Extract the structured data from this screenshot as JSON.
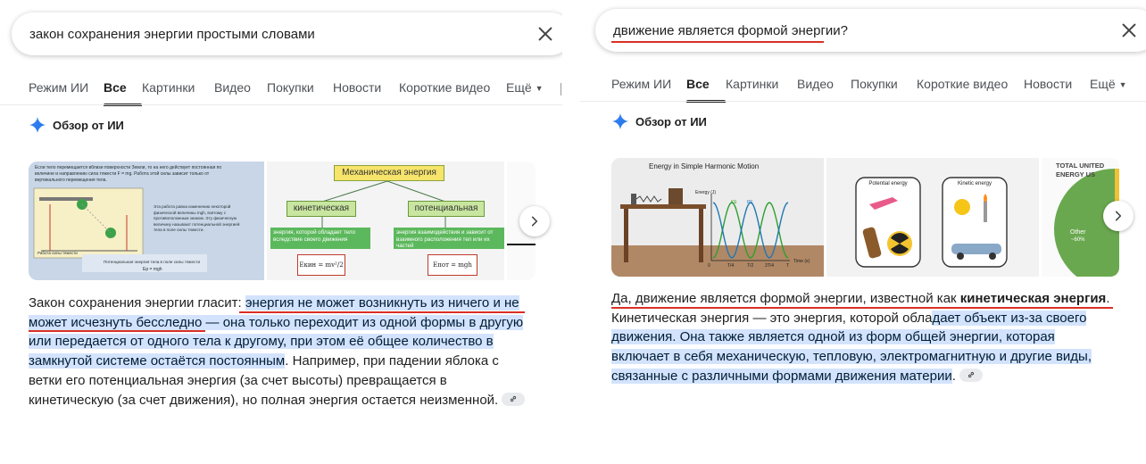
{
  "left": {
    "search": {
      "query": "закон сохранения энергии простыми словами"
    },
    "tabs": [
      {
        "label": "Режим ИИ"
      },
      {
        "label": "Все"
      },
      {
        "label": "Картинки"
      },
      {
        "label": "Видео"
      },
      {
        "label": "Покупки"
      },
      {
        "label": "Новости"
      },
      {
        "label": "Короткие видео"
      },
      {
        "label": "Ещё"
      }
    ],
    "ai_overview": {
      "label": "Обзор от ИИ"
    },
    "images": {
      "img1": {
        "lines": [
          "Если тело перемещается вблизи поверхности Земли, то на него действует постоянная по",
          "величине и направлению сила тяжести F = mg. Работа этой силы зависит только от",
          "вертикального перемещения тела.",
          "Эта работа равна изменению некоторой",
          "физической величины mgh, взятому с",
          "противоположным знаком. Эту физическую",
          "величину называют потенциальной энергией",
          "тела в поле силы тяжести.",
          "Работа силы тяжести",
          "Потенциальная энергия тела в поле силы тяжести"
        ],
        "formula": "Ep = mgh"
      },
      "img2": {
        "title": "Механическая энергия",
        "kinetic": "кинетическая",
        "potential": "потенциальная",
        "kinetic_desc": "энергия, которой обладает тело вследствие своего движения",
        "potential_desc": "энергия взаимодействия и зависит от взаимного расположения тел или их частей",
        "kinetic_formula": "Eкин = mv²/2",
        "potential_formula": "Eпот = mgh"
      }
    },
    "answer": {
      "p1": "Закон сохранения энергии гласит: ",
      "p2": "энергия не может возникнуть из ничего и не может исчезнуть бесследно",
      "p3": " — она только переходит из одной формы в другую или передается от одного тела к другому, при этом её общее количество в замкнутой системе остаётся постоянным",
      "p4": ". Например, при падении яблока с ветки его потенциальная энергия (за счет высоты) превращается в кинетическую (за счет движения), но полная энергия остается неизменной."
    }
  },
  "right": {
    "search": {
      "query": "движение является формой энергии?"
    },
    "tabs": [
      {
        "label": "Режим ИИ"
      },
      {
        "label": "Все"
      },
      {
        "label": "Картинки"
      },
      {
        "label": "Видео"
      },
      {
        "label": "Покупки"
      },
      {
        "label": "Короткие видео"
      },
      {
        "label": "Новости"
      },
      {
        "label": "Ещё"
      }
    ],
    "ai_overview": {
      "label": "Обзор от ИИ"
    },
    "images": {
      "img1": {
        "title": "Energy in Simple Harmonic Motion",
        "ylabel": "Energy (J)",
        "ke": "KE",
        "pe": "PE",
        "xlabel": "Time (s)",
        "ticks": [
          "0",
          "T/4",
          "T/2",
          "3T/4",
          "T"
        ]
      },
      "img2": {
        "potential": "Potential energy",
        "kinetic": "Kinetic energy"
      },
      "img3": {
        "title": "TOTAL UNITED ENERGY US",
        "other": "Other",
        "other_pct": "~60%"
      }
    },
    "answer": {
      "p1": "Да, движение является формой энергии, известной как ",
      "p2": "кинетическая энергия",
      "p3": ". Кинетическая энергия — это энергия, которой обла",
      "p4": "дает объект из-за своего движения. Она также является одной из форм общей энергии, которая включает в себя механическую, тепловую, электромагнитную и другие виды, связанные с различными формами движения материи",
      "p5": "."
    }
  },
  "colors": {
    "highlight": "#d3e3fd",
    "annotation_red": "#d93025",
    "accent_blue": "#1a73e8"
  }
}
